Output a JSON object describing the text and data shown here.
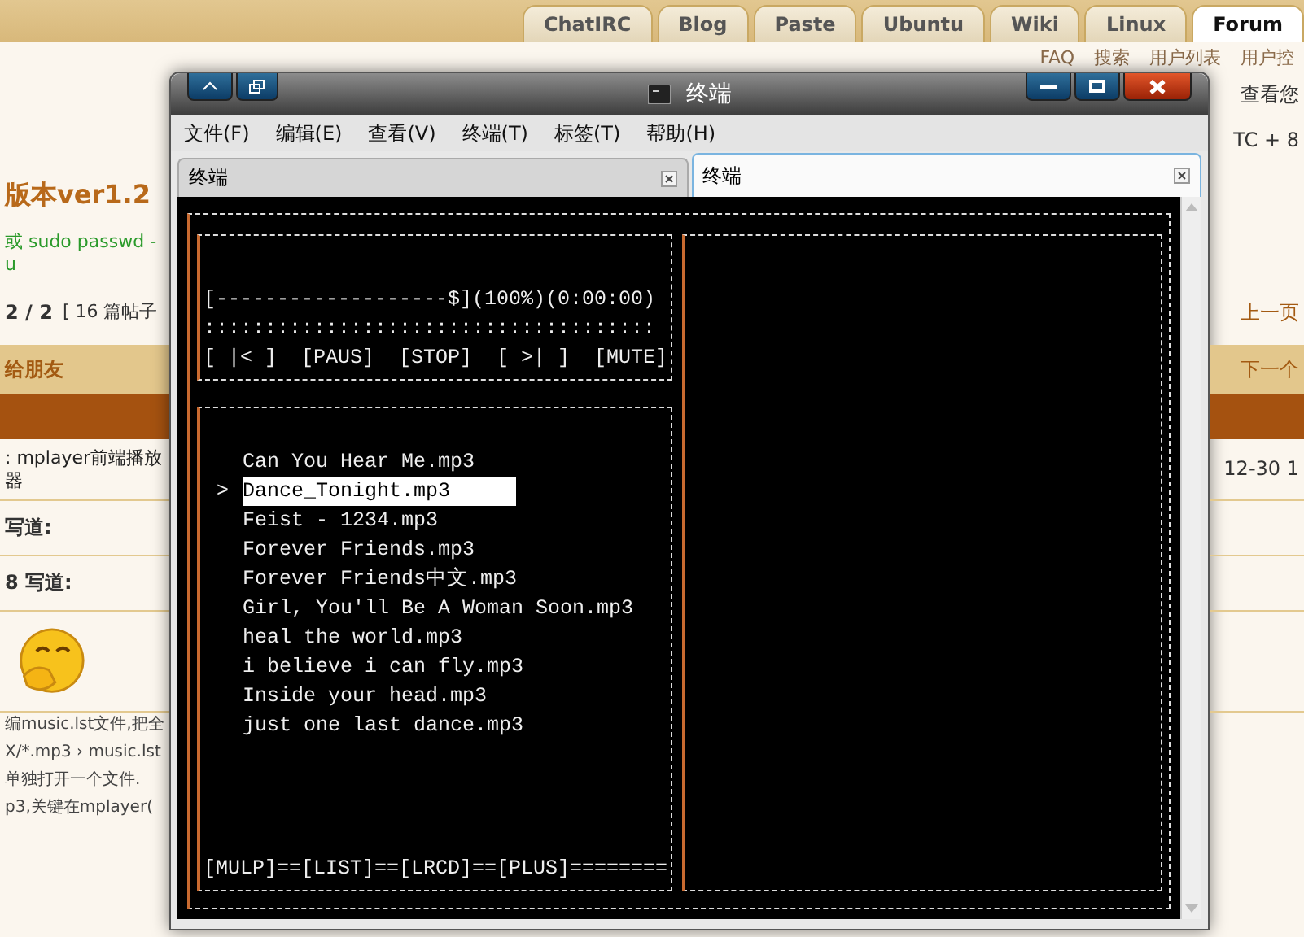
{
  "browser_tabs": [
    {
      "label": "ChatIRC",
      "selected": false
    },
    {
      "label": "Blog",
      "selected": false
    },
    {
      "label": "Paste",
      "selected": false
    },
    {
      "label": "Ubuntu",
      "selected": false
    },
    {
      "label": "Wiki",
      "selected": false
    },
    {
      "label": "Linux",
      "selected": false
    },
    {
      "label": "Forum",
      "selected": true
    }
  ],
  "forum": {
    "header_links": [
      "FAQ",
      "搜索",
      "用户列表",
      "用户控"
    ],
    "rows": [
      {
        "kind": "plain",
        "right": "查看您"
      },
      {
        "kind": "plain",
        "right": "TC + 8"
      },
      {
        "kind": "title",
        "left": "版本ver1.2"
      },
      {
        "kind": "note",
        "left": "或 sudo passwd -u"
      },
      {
        "kind": "pager",
        "left": "2 / 2",
        "left_extra": "[ 16 篇帖子",
        "right": "上一页"
      },
      {
        "kind": "band",
        "left": "给朋友",
        "right": "下一个"
      },
      {
        "kind": "dark"
      },
      {
        "kind": "topic",
        "left": ": mplayer前端播放器",
        "right": "12-30 1"
      },
      {
        "kind": "author",
        "left": "写道:"
      },
      {
        "kind": "author",
        "left": "8 写道:"
      },
      {
        "kind": "emoji"
      },
      {
        "kind": "text",
        "left": "编music.lst文件,把全"
      },
      {
        "kind": "text",
        "left": "X/*.mp3 › music.lst"
      },
      {
        "kind": "text",
        "left": "单独打开一个文件."
      },
      {
        "kind": "text",
        "left": "p3,关键在mplayer("
      }
    ]
  },
  "window": {
    "title": "终端",
    "menu": [
      "文件(F)",
      "编辑(E)",
      "查看(V)",
      "终端(T)",
      "标签(T)",
      "帮助(H)"
    ],
    "tabs": [
      {
        "label": "终端",
        "selected": false
      },
      {
        "label": "终端",
        "selected": true
      }
    ],
    "player": {
      "progress": "[-------------------$](100%)(0:00:00)",
      "meter": ":::::::::::::::::::::::::::::::::::::",
      "controls": [
        "[ |< ]",
        "[PAUS]",
        "[STOP]",
        "[ >| ]",
        "[MUTE]"
      ]
    },
    "playlist": {
      "cursor": ">",
      "items": [
        {
          "name": "Can You Hear Me.mp3",
          "selected": false
        },
        {
          "name": "Dance_Tonight.mp3",
          "selected": true
        },
        {
          "name": "Feist - 1234.mp3",
          "selected": false
        },
        {
          "name": "Forever Friends.mp3",
          "selected": false
        },
        {
          "name": "Forever Friends中文.mp3",
          "selected": false
        },
        {
          "name": "Girl, You'll Be A Woman Soon.mp3",
          "selected": false
        },
        {
          "name": "heal the world.mp3",
          "selected": false
        },
        {
          "name": "i believe i can fly.mp3",
          "selected": false
        },
        {
          "name": "Inside your head.mp3",
          "selected": false
        },
        {
          "name": "just one last dance.mp3",
          "selected": false
        }
      ]
    },
    "footer": "[MULP]==[LIST]==[LRCD]==[PLUS]========"
  }
}
